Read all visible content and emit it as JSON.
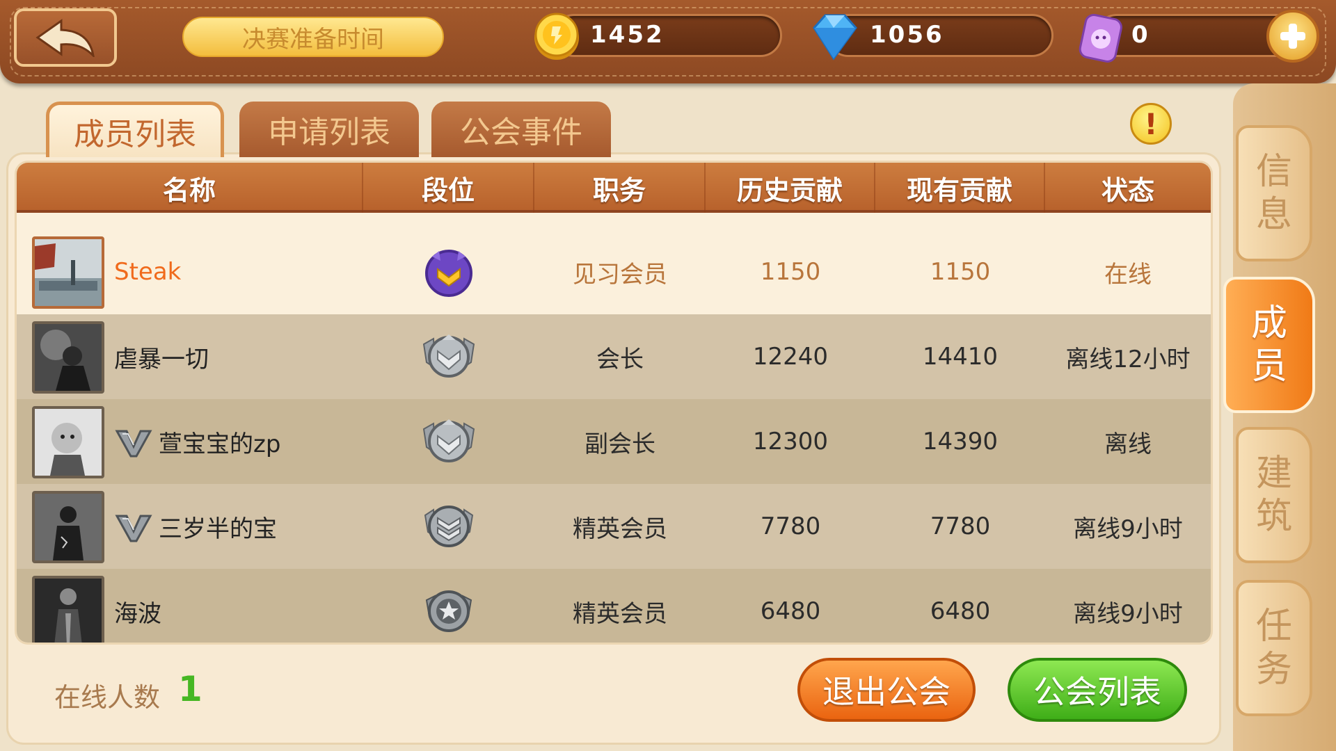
{
  "header": {
    "prep_label": "决赛准备时间",
    "gold": "1452",
    "diamond": "1056",
    "ticket": "0"
  },
  "tabs": [
    {
      "label": "成员列表",
      "active": true
    },
    {
      "label": "申请列表",
      "active": false
    },
    {
      "label": "公会事件",
      "active": false
    }
  ],
  "table": {
    "columns": [
      "名称",
      "段位",
      "职务",
      "历史贡献",
      "现有贡献",
      "状态"
    ],
    "rows": [
      {
        "name": "Steak",
        "vip": false,
        "rank_icon": "purple-rank-icon",
        "role": "见习会员",
        "history": "1150",
        "current": "1150",
        "status": "在线"
      },
      {
        "name": "虐暴一切",
        "vip": false,
        "rank_icon": "silver-wing-rank-icon",
        "role": "会长",
        "history": "12240",
        "current": "14410",
        "status": "离线12小时"
      },
      {
        "name": "萱宝宝的zp",
        "vip": true,
        "rank_icon": "silver-wing-rank-icon",
        "role": "副会长",
        "history": "12300",
        "current": "14390",
        "status": "离线"
      },
      {
        "name": "三岁半的宝",
        "vip": true,
        "rank_icon": "silver-chevron-rank-icon",
        "role": "精英会员",
        "history": "7780",
        "current": "7780",
        "status": "离线9小时"
      },
      {
        "name": "海波",
        "vip": false,
        "rank_icon": "silver-star-rank-icon",
        "role": "精英会员",
        "history": "6480",
        "current": "6480",
        "status": "离线9小时"
      }
    ]
  },
  "footer": {
    "online_label": "在线人数",
    "online_count": "1",
    "quit_button": "退出公会",
    "list_button": "公会列表"
  },
  "side_tabs": [
    {
      "line1": "信",
      "line2": "息",
      "active": false
    },
    {
      "line1": "成",
      "line2": "员",
      "active": true
    },
    {
      "line1": "建",
      "line2": "筑",
      "active": false
    },
    {
      "line1": "任",
      "line2": "务",
      "active": false
    }
  ],
  "colors": {
    "accent_orange": "#f07a16",
    "header_brown": "#a55a2c",
    "online_green": "#46b723"
  }
}
